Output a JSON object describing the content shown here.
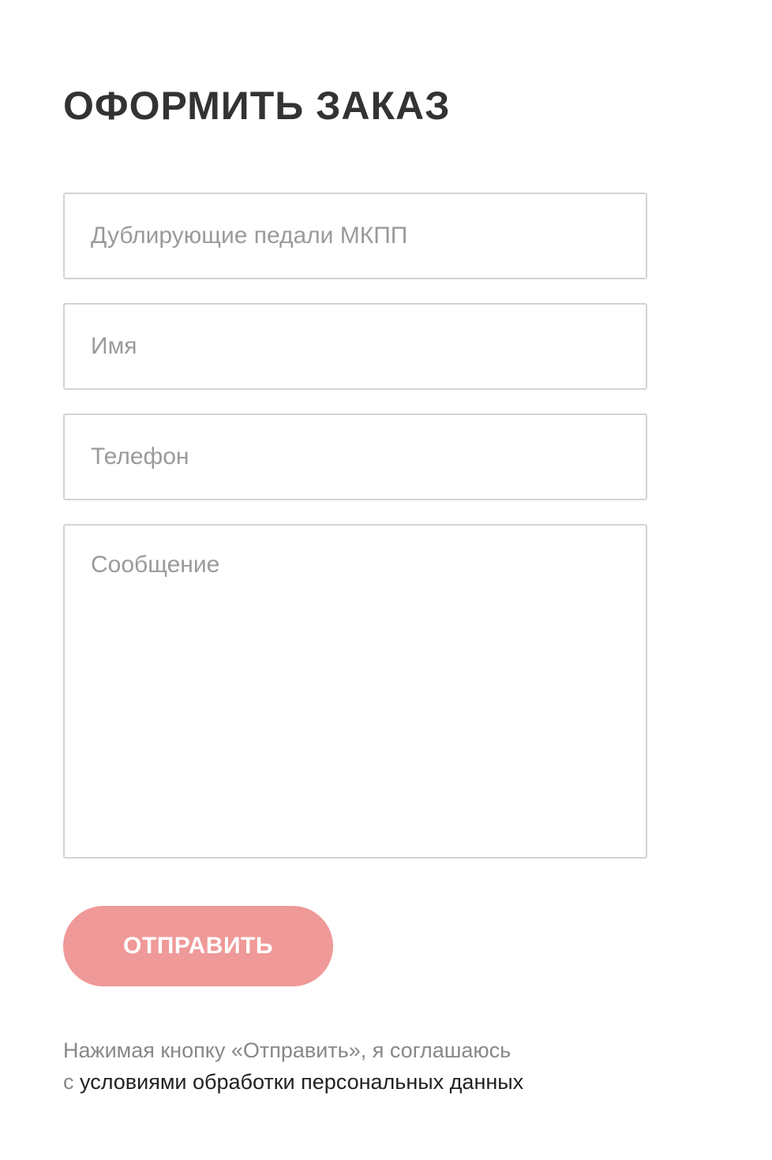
{
  "form": {
    "title": "ОФОРМИТЬ ЗАКАЗ",
    "fields": {
      "product": {
        "value": "",
        "placeholder": "Дублирующие педали МКПП"
      },
      "name": {
        "value": "",
        "placeholder": "Имя"
      },
      "phone": {
        "value": "",
        "placeholder": "Телефон"
      },
      "message": {
        "value": "",
        "placeholder": "Сообщение"
      }
    },
    "submit_label": "ОТПРАВИТЬ",
    "consent": {
      "line1": "Нажимая кнопку «Отправить», я соглашаюсь",
      "prefix": "с",
      "link_text": "условиями обработки персональных данных"
    }
  },
  "colors": {
    "background": "#ffffff",
    "title": "#333333",
    "field_border": "#d3d3d3",
    "placeholder": "#9a9a9a",
    "button_bg": "#ef9998",
    "button_text": "#ffffff",
    "consent_text": "#888888",
    "link_text": "#222222"
  }
}
